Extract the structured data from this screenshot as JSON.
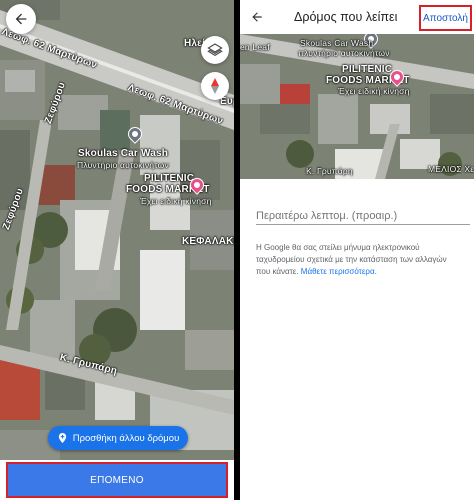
{
  "left_panel": {
    "map_labels": {
      "street_1": "Λεωφ. 62 Μαρτύρων",
      "street_2": "Λεωφ. 62 Μαρτύρων",
      "street_3": "Ζεφύρου",
      "street_4": "Ζεφύρου",
      "street_5": "Ευρ",
      "street_6": "Ηλεί",
      "street_7": "Κ. Γρυπάρη",
      "carwash_name": "Skoulas Car Wash",
      "carwash_sub": "Πλυντήριο αυτοκινήτων",
      "market_name_1": "PILITENIC",
      "market_name_2": "FOODS MARKET",
      "market_sub": "Έχει ειδική κίνηση",
      "kefalakis": "ΚΕΦΑΛΑΚΗ Ε"
    },
    "add_road_label": "Προσθήκη άλλου δρόμου",
    "next_label": "ΕΠΟΜΕΝΟ"
  },
  "right_panel": {
    "title": "Δρόμος που λείπει",
    "send_label": "Αποστολή",
    "map_labels": {
      "leaf": "en Leaf",
      "carwash_name": "Skoulas Car Wash",
      "carwash_sub": "πλυντήριο αυτοκινήτων",
      "market_name_1": "PILITENIC",
      "market_name_2": "FOODS MARKET",
      "market_sub": "Έχει ειδική κίνηση",
      "gripari": "Κ. Γρυπάρη",
      "melios": "ΜΕΛΙΟΣ Χε"
    },
    "details_placeholder": "Περαιτέρω λεπτομ. (προαιρ.)",
    "notice_text": "Η Google θα σας στείλει μήνυμα ηλεκτρονικού ταχυδρομείου σχετικά με την κατάσταση των αλλαγών που κάνατε.",
    "learn_more": "Μάθετε περισσότερα."
  },
  "colors": {
    "accent_blue": "#3b79e8",
    "highlight_red": "#d72028",
    "link_blue": "#1a73e8"
  },
  "icons": [
    "back-arrow-icon",
    "layers-icon",
    "compass-icon",
    "add-location-icon",
    "shopping-pin-icon",
    "carwash-pin-icon"
  ]
}
